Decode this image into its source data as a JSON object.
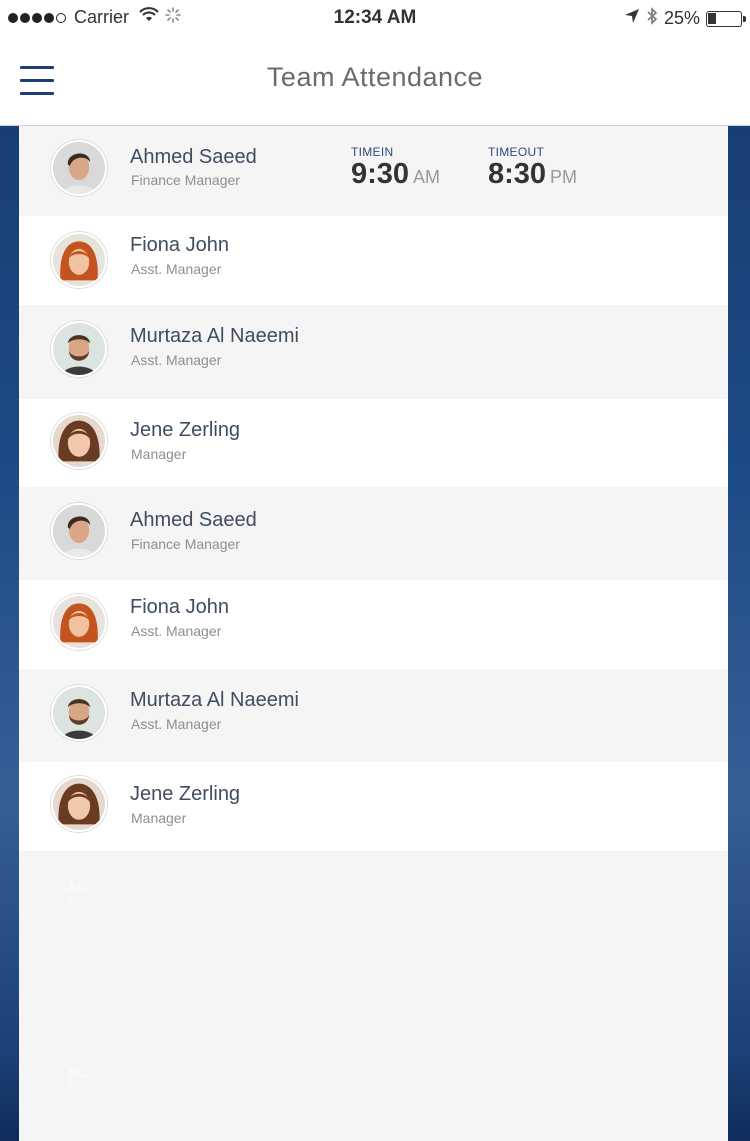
{
  "status_bar": {
    "carrier": "Carrier",
    "time": "12:34 AM",
    "battery_percent": "25%",
    "battery_level": 0.25,
    "signal_bars_filled": 4,
    "signal_bars_total": 5,
    "icons": [
      "wifi-icon",
      "loading-spinner-icon",
      "location-arrow-icon",
      "bluetooth-icon",
      "battery-icon"
    ]
  },
  "header": {
    "title": "Team Attendance",
    "menu_icon": "hamburger-menu-icon",
    "accent_color": "#1d3d74"
  },
  "attendance_labels": {
    "timein": "TIMEIN",
    "timeout": "TIMEOUT"
  },
  "employees": [
    {
      "name": "Ahmed Saeed",
      "role": "Finance Manager",
      "avatar": "man-dark-hair",
      "time_in": "9:30",
      "time_in_period": "AM",
      "time_out": "8:30",
      "time_out_period": "PM"
    },
    {
      "name": "Fiona John",
      "role": "Asst. Manager",
      "avatar": "woman-red-hair"
    },
    {
      "name": "Murtaza Al Naeemi",
      "role": "Asst. Manager",
      "avatar": "man-beard"
    },
    {
      "name": "Jene Zerling",
      "role": "Manager",
      "avatar": "woman-brown-hair"
    },
    {
      "name": "Ahmed Saeed",
      "role": "Finance Manager",
      "avatar": "man-dark-hair"
    },
    {
      "name": "Fiona John",
      "role": "Asst. Manager",
      "avatar": "woman-red-hair"
    },
    {
      "name": "Murtaza Al Naeemi",
      "role": "Asst. Manager",
      "avatar": "man-beard"
    },
    {
      "name": "Jene Zerling",
      "role": "Manager",
      "avatar": "woman-brown-hair"
    }
  ],
  "watermarks": [
    {
      "line1": "JUL",
      "line2": "Y"
    },
    {
      "line1": "JUL",
      "line2": "Y"
    }
  ]
}
